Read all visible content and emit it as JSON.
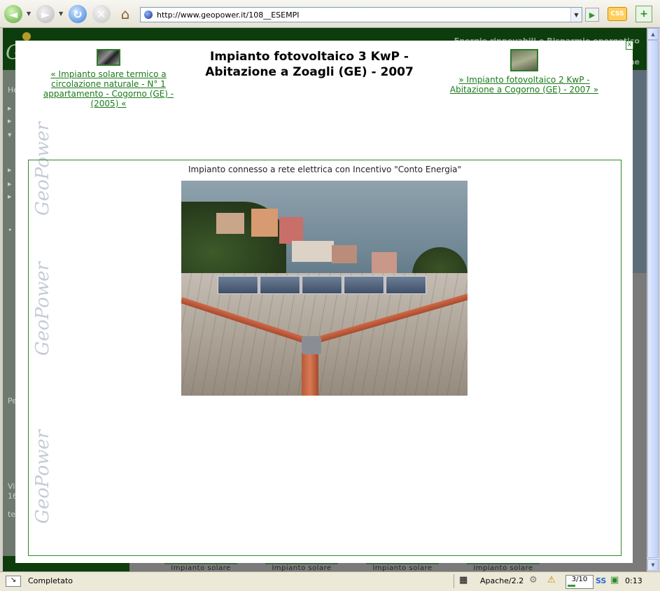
{
  "browser": {
    "url": "http://www.geopower.it/108__ESEMPI",
    "css_badge": "CSS",
    "back_label": "◄",
    "fwd_label": "►",
    "reload_label": "↻",
    "stop_label": "✕",
    "home_label": "⌂",
    "go_label": "▶",
    "ext_label": "+"
  },
  "site": {
    "header_line1": "Energie rinnovabili e Risparmio energetico",
    "header_line2": "he",
    "logo": "G",
    "left_letters": [
      "He",
      "▸",
      "▸",
      "▾",
      "▸",
      "▸",
      "▸",
      "•",
      "Pe",
      "Vi",
      "16",
      "te"
    ],
    "bottom_tabs": [
      "Impianto solare",
      "Impianto solare",
      "Impianto solare",
      "Impianto solare"
    ]
  },
  "modal": {
    "close_label": "x",
    "title": "Impianto fotovoltaico 3 KwP - Abitazione a Zoagli (GE) - 2007",
    "prev_link": "« Impianto solare termico a circolazione naturale - N° 1 appartamento - Cogorno (GE) - (2005) «",
    "next_link": "» Impianto fotovoltaico 2 KwP - Abitazione a Cogorno (GE) - 2007 »",
    "caption": "Impianto connesso a rete elettrica con Incentivo \"Conto Energia\"",
    "watermark": "GeoPower"
  },
  "statusbar": {
    "status": "Completato",
    "server": "Apache/2.2",
    "progress": "3/10",
    "progress_fraction": 0.3,
    "ss_label": "SS",
    "time": "0:13"
  },
  "colors": {
    "accent_green": "#2d8a2d",
    "link_green": "#1a7a1a",
    "header_green": "#0d3d0d"
  },
  "icons": {
    "back": "back-arrow-icon",
    "forward": "forward-arrow-icon",
    "reload": "reload-icon",
    "stop": "stop-icon",
    "home": "home-icon",
    "site_favicon": "globe-icon",
    "go": "go-arrow-icon"
  }
}
